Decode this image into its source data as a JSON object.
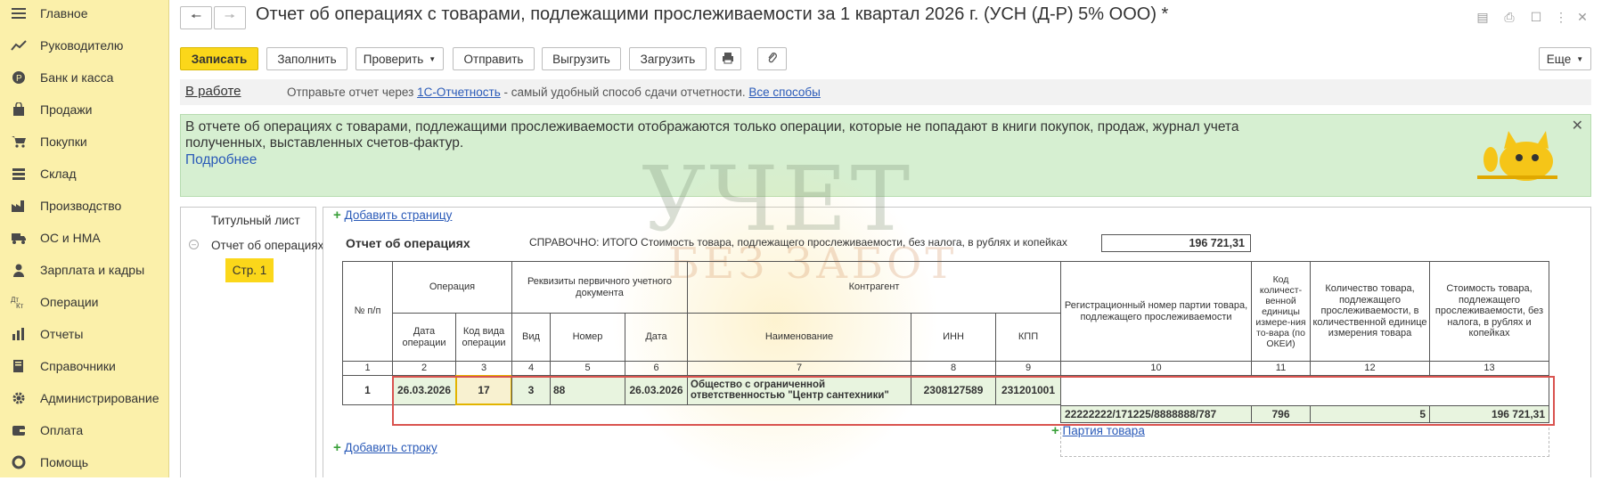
{
  "sidebar": {
    "items": [
      {
        "label": "Главное",
        "icon": "menu-icon"
      },
      {
        "label": "Руководителю",
        "icon": "chart-line-icon"
      },
      {
        "label": "Банк и касса",
        "icon": "coin-icon"
      },
      {
        "label": "Продажи",
        "icon": "bag-icon"
      },
      {
        "label": "Покупки",
        "icon": "cart-icon"
      },
      {
        "label": "Склад",
        "icon": "warehouse-icon"
      },
      {
        "label": "Производство",
        "icon": "factory-icon"
      },
      {
        "label": "ОС и НМА",
        "icon": "truck-icon"
      },
      {
        "label": "Зарплата и кадры",
        "icon": "person-icon"
      },
      {
        "label": "Операции",
        "icon": "dt-kt-icon"
      },
      {
        "label": "Отчеты",
        "icon": "bar-chart-icon"
      },
      {
        "label": "Справочники",
        "icon": "book-icon"
      },
      {
        "label": "Администрирование",
        "icon": "gear-icon"
      },
      {
        "label": "Оплата",
        "icon": "wallet-icon"
      },
      {
        "label": "Помощь",
        "icon": "lifebuoy-icon"
      }
    ]
  },
  "header": {
    "title": "Отчет об операциях с товарами, подлежащими прослеживаемости за 1 квартал 2026 г. (УСН (Д-Р) 5% ООО) *"
  },
  "toolbar": {
    "save": "Записать",
    "fill": "Заполнить",
    "check": "Проверить",
    "send": "Отправить",
    "export": "Выгрузить",
    "import": "Загрузить",
    "more": "Еще"
  },
  "status": {
    "in_work": "В работе",
    "send_prefix": "Отправьте отчет через",
    "send_link": "1С-Отчетность",
    "send_suffix": "- самый удобный способ сдачи отчетности.",
    "all_ways": "Все способы"
  },
  "info": {
    "text": "В отчете об операциях с товарами, подлежащими прослеживаемости отображаются только операции, которые не попадают в книги покупок, продаж, журнал учета полученных, выставленных счетов-фактур.",
    "more": "Подробнее"
  },
  "tree": {
    "title_page": "Титульный лист",
    "report": "Отчет об операциях",
    "page": "Стр. 1"
  },
  "document": {
    "add_page": "Добавить страницу",
    "name": "Отчет об операциях",
    "reference": "СПРАВОЧНО: ИТОГО Стоимость товара, подлежащего прослеживаемости, без налога, в рублях и копейках",
    "total": "196 721,31",
    "headers": {
      "num": "№ п/п",
      "operation": "Операция",
      "op_date": "Дата операции",
      "op_code": "Код вида операции",
      "doc_req": "Реквизиты первичного учетного документа",
      "doc_kind": "Вид",
      "doc_num": "Номер",
      "doc_date": "Дата",
      "counterparty": "Контрагент",
      "cp_name": "Наименование",
      "cp_inn": "ИНН",
      "cp_kpp": "КПП",
      "reg_num": "Регистрационный номер партии товара, подлежащего прослеживаемости",
      "unit_code": "Код количест-венной единицы измере-ния то-вара (по ОКЕИ)",
      "qty": "Количество товара, подлежащего прослеживаемости, в количественной единице измерения товара",
      "cost": "Стоимость товара, подлежащего прослеживаемости, без налога, в рублях и копейках"
    },
    "col_numbers": [
      "1",
      "2",
      "3",
      "4",
      "5",
      "6",
      "7",
      "8",
      "9",
      "10",
      "11",
      "12",
      "13"
    ],
    "row": {
      "n": "1",
      "op_date": "26.03.2026",
      "op_code": "17",
      "doc_kind": "3",
      "doc_num": "88",
      "doc_date": "26.03.2026",
      "cp_name": "Общество с ограниченной ответственностью \"Центр сантехники\"",
      "cp_inn": "2308127589",
      "cp_kpp": "231201001"
    },
    "batch": {
      "reg_num": "22222222/171225/8888888/787",
      "unit_code": "796",
      "qty": "5",
      "cost": "196 721,31"
    },
    "add_row": "Добавить строку",
    "batch_link": "Партия товара"
  },
  "watermark": {
    "line1": "УЧЕТ",
    "line2": "БЕЗ ЗАБОТ"
  },
  "colors": {
    "sidebar": "#fbf0aa",
    "accent": "#fbd71a",
    "info_bg": "#d6efd1",
    "highlight": "#d9534f",
    "link": "#2a5ab8"
  }
}
